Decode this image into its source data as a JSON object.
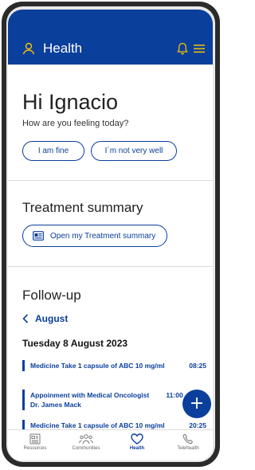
{
  "header": {
    "title": "Health",
    "user_icon": "user-icon",
    "bell_icon": "bell-icon",
    "menu_icon": "menu-icon",
    "color": "#0a3f9c"
  },
  "greeting": {
    "title": "Hi Ignacio",
    "subtitle": "How are you feeling today?"
  },
  "mood": {
    "fine_label": "I am fine",
    "not_well_label": "I´m not very well"
  },
  "treatment": {
    "title": "Treatment summary",
    "open_label": "Open my Treatment summary",
    "icon": "document-icon"
  },
  "followup": {
    "title": "Follow-up",
    "month": "August",
    "date": "Tuesday 8 August 2023",
    "events": [
      {
        "line1": "Medicine  Take 1 capsule of ABC 10 mg/ml",
        "line2": "",
        "time": "08:25"
      },
      {
        "line1": "Appoinment with Medical Oncologist",
        "line2": "Dr. James Mack",
        "time": "11:00 - 12:00"
      },
      {
        "line1": "Medicine  Take 1 capsule of ABC 10 mg/ml",
        "line2": "",
        "time": "20:25"
      }
    ]
  },
  "fab": {
    "label": "+"
  },
  "tabbar": {
    "items": [
      {
        "label": "Resources",
        "icon": "resources-icon"
      },
      {
        "label": "Communities",
        "icon": "communities-icon"
      },
      {
        "label": "Health",
        "icon": "heart-icon",
        "active": true
      },
      {
        "label": "Telehealth",
        "icon": "phone-icon"
      }
    ]
  }
}
